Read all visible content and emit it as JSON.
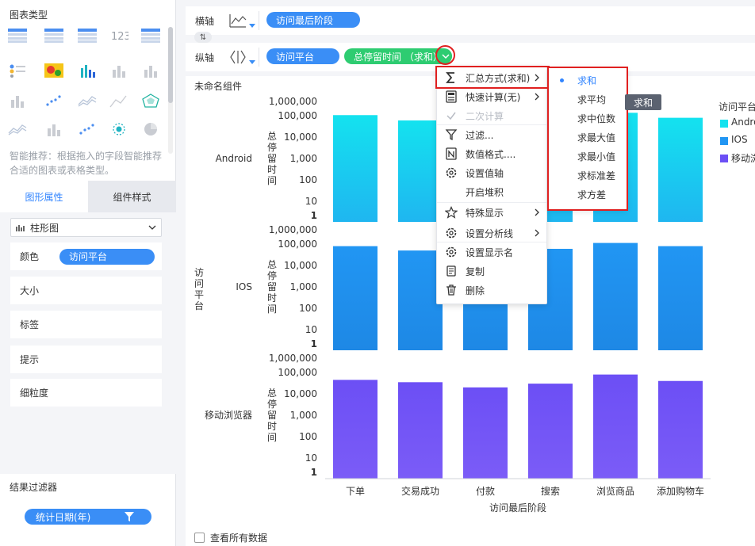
{
  "left_panel": {
    "chart_type_title": "图表类型",
    "recommend_text": "智能推荐：根据拖入的字段智能推荐合适的图表或表格类型。",
    "tabs": [
      {
        "label": "图形属性"
      },
      {
        "label": "组件样式"
      }
    ],
    "chart_select": "柱形图",
    "props": {
      "color_label": "颜色",
      "color_field": "访问平台",
      "size_label": "大小",
      "label_label": "标签",
      "tooltip_label": "提示",
      "granularity_label": "细粒度"
    },
    "filter_title": "结果过滤器",
    "filter_field": "统计日期(年)",
    "chart_type_icons": [
      "table-icon",
      "table-icon",
      "table-icon",
      "number-icon",
      "table-icon",
      "dot-matrix-icon",
      "heatmap-icon",
      "bar-grid-icon",
      "bar-icon",
      "bar-icon",
      "bar-icon",
      "scatter-icon",
      "line-icon",
      "area-icon",
      "radar-icon",
      "line-icon",
      "bar-icon",
      "scatter-icon",
      "bubble-icon",
      "pie-icon"
    ]
  },
  "axes": {
    "x_label": "横轴",
    "x_field": "访问最后阶段",
    "y_label": "纵轴",
    "y_fields": [
      "访问平台",
      "总停留时间 （求和）"
    ]
  },
  "component_title": "未命名组件",
  "menu": {
    "items": [
      {
        "label": "汇总方式(求和)",
        "icon": "sigma-icon",
        "has_sub": true
      },
      {
        "label": "快速计算(无)",
        "icon": "calculator-icon",
        "has_sub": true
      },
      {
        "label": "二次计算",
        "icon": "check-icon",
        "disabled": true
      },
      {
        "label": "过滤...",
        "icon": "filter-icon"
      },
      {
        "label": "数值格式....",
        "icon": "format-icon"
      },
      {
        "label": "设置值轴",
        "icon": "gear-icon"
      },
      {
        "label": "开启堆积",
        "icon": ""
      },
      {
        "label": "特殊显示",
        "icon": "star-icon",
        "has_sub": true
      },
      {
        "label": "设置分析线",
        "icon": "gear-icon",
        "has_sub": true
      },
      {
        "label": "设置显示名",
        "icon": "gear-icon"
      },
      {
        "label": "复制",
        "icon": "copy-icon"
      },
      {
        "label": "删除",
        "icon": "trash-icon"
      }
    ],
    "submenu": [
      {
        "label": "求和",
        "active": true
      },
      {
        "label": "求平均"
      },
      {
        "label": "求中位数"
      },
      {
        "label": "求最大值"
      },
      {
        "label": "求最小值"
      },
      {
        "label": "求标准差"
      },
      {
        "label": "求方差"
      }
    ],
    "tooltip": "求和"
  },
  "legend": {
    "title": "访问平台",
    "items": [
      {
        "name": "Android",
        "color": "#14e2ef"
      },
      {
        "name": "IOS",
        "color": "#2196f3"
      },
      {
        "name": "移动浏览器",
        "color": "#6c4ff5"
      }
    ]
  },
  "show_all_label": "查看所有数据",
  "chart_data": {
    "type": "bar",
    "log_scale": true,
    "x_axis_label": "访问最后阶段",
    "row_axis_label": "访问平台",
    "y_axis_label": "总停留时间",
    "y_ticks": [
      "1",
      "10",
      "100",
      "1,000",
      "10,000",
      "100,000",
      "1,000,000"
    ],
    "categories": [
      "下单",
      "交易成功",
      "付款",
      "搜索",
      "浏览商品",
      "添加购物车"
    ],
    "panels": [
      {
        "name": "Android",
        "colors": [
          "#14e2ef",
          "#1fb6f0"
        ],
        "values": [
          110000,
          60000,
          40000,
          55000,
          160000,
          80000
        ]
      },
      {
        "name": "IOS",
        "colors": [
          "#2196f3",
          "#1e88e5"
        ],
        "values": [
          80000,
          50000,
          30000,
          60000,
          120000,
          80000
        ]
      },
      {
        "name": "移动浏览器",
        "colors": [
          "#6c4ff5",
          "#7b5cf7"
        ],
        "values": [
          45000,
          35000,
          20000,
          30000,
          80000,
          40000
        ]
      }
    ]
  }
}
